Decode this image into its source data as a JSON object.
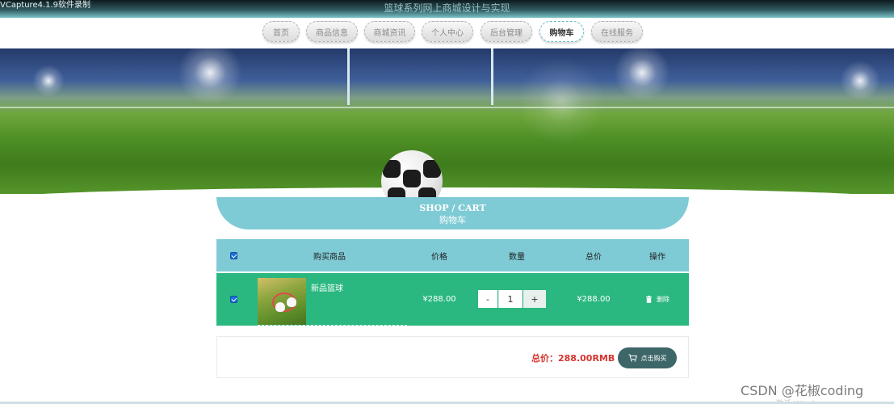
{
  "window": {
    "watermark": "VCapture4.1.9软件录制",
    "site_title": "篮球系列网上商城设计与实现"
  },
  "nav": {
    "items": [
      {
        "label": "首页",
        "active": false
      },
      {
        "label": "商品信息",
        "active": false
      },
      {
        "label": "商城资讯",
        "active": false
      },
      {
        "label": "个人中心",
        "active": false
      },
      {
        "label": "后台管理",
        "active": false
      },
      {
        "label": "购物车",
        "active": true
      },
      {
        "label": "在线服务",
        "active": false
      }
    ]
  },
  "cart": {
    "title_en": "SHOP / CART",
    "title_cn": "购物车",
    "columns": {
      "product": "购买商品",
      "price": "价格",
      "quantity": "数量",
      "total": "总价",
      "action": "操作"
    },
    "items": [
      {
        "name": "新品篮球",
        "price": "¥288.00",
        "quantity": "1",
        "total": "¥288.00",
        "selected": true
      }
    ],
    "minus_label": "-",
    "plus_label": "+",
    "delete_label": "删除",
    "grand_total_label": "总价：288.00RMB",
    "buy_label": "点击购买"
  },
  "footer": {
    "csdn_watermark": "CSDN @花椒coding",
    "os_hint": "激活 Windows"
  },
  "colors": {
    "accent": "#7fcbd5",
    "row_bg": "#2bb880",
    "total_red": "#d7342f",
    "buy_button": "#3d6669"
  }
}
